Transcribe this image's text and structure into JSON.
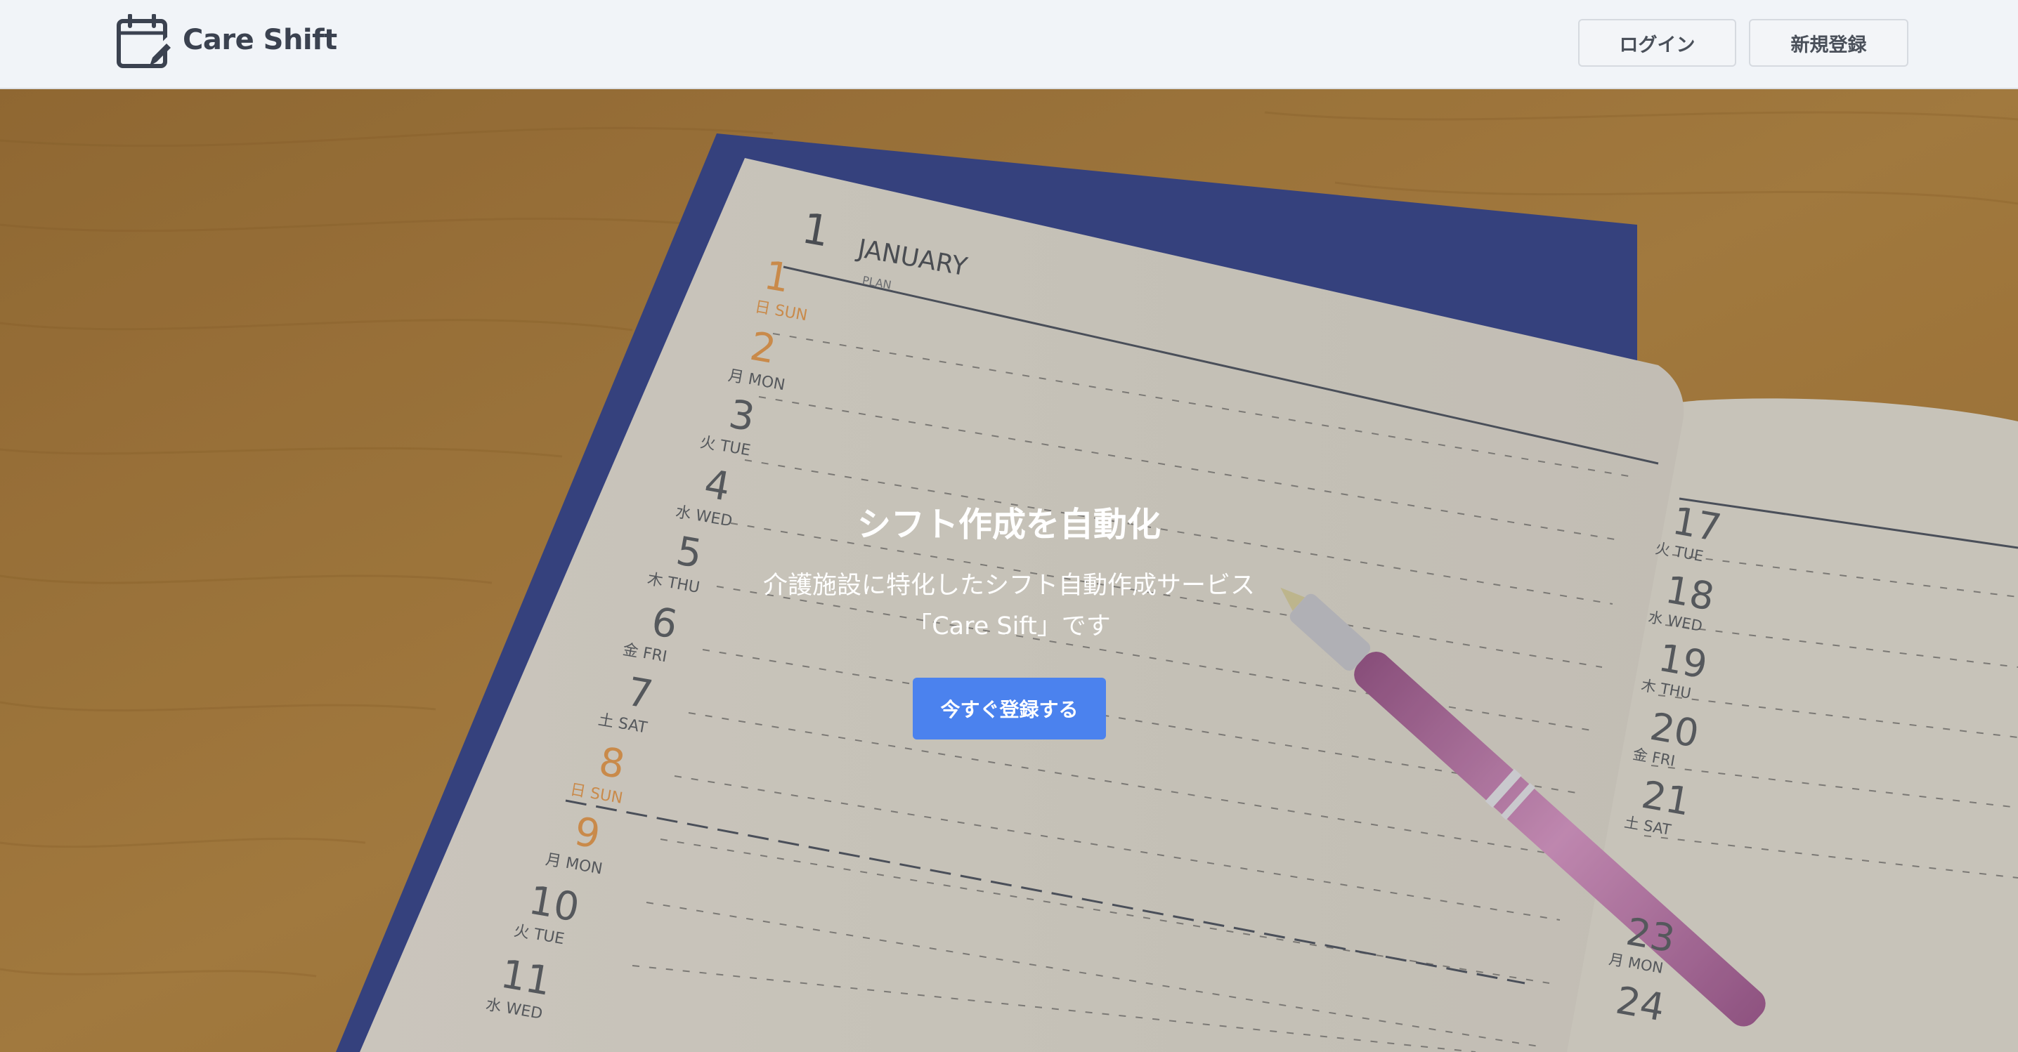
{
  "header": {
    "logo_icon": "calendar-edit-icon",
    "brand": "Care Shift",
    "login_label": "ログイン",
    "register_label": "新規登録"
  },
  "hero": {
    "title": "シフト作成を自動化",
    "subtitle_line1": "介護施設に特化したシフト自動作成サービス",
    "subtitle_line2": "「Care Sift」です",
    "cta_label": "今すぐ登録する",
    "background_image": "open planner with pink pen on wooden desk"
  },
  "planner": {
    "month_number": "1",
    "month_name": "JANUARY",
    "plan_label": "PLAN",
    "left_days": [
      {
        "n": "1",
        "d": "日 SUN"
      },
      {
        "n": "2",
        "d": "月 MON"
      },
      {
        "n": "3",
        "d": "火 TUE"
      },
      {
        "n": "4",
        "d": "水 WED"
      },
      {
        "n": "5",
        "d": "木 THU"
      },
      {
        "n": "6",
        "d": "金 FRI"
      },
      {
        "n": "7",
        "d": "土 SAT"
      },
      {
        "n": "8",
        "d": "日 SUN"
      },
      {
        "n": "9",
        "d": "月 MON"
      },
      {
        "n": "10",
        "d": "火 TUE"
      },
      {
        "n": "11",
        "d": "水 WED"
      }
    ],
    "right_days": [
      {
        "n": "17",
        "d": "火 TUE"
      },
      {
        "n": "18",
        "d": "水 WED"
      },
      {
        "n": "19",
        "d": "木 THU"
      },
      {
        "n": "20",
        "d": "金 FRI"
      },
      {
        "n": "21",
        "d": "土 SAT"
      },
      {
        "n": "23",
        "d": "月 MON"
      },
      {
        "n": "24",
        "d": ""
      }
    ]
  },
  "colors": {
    "header_bg": "#f1f4f8",
    "brand_text": "#3b4250",
    "cta_bg": "#4b82ee",
    "sunday_number": "#c98a4a",
    "weekday_number": "#55585c",
    "pen": "#c27fb0"
  }
}
